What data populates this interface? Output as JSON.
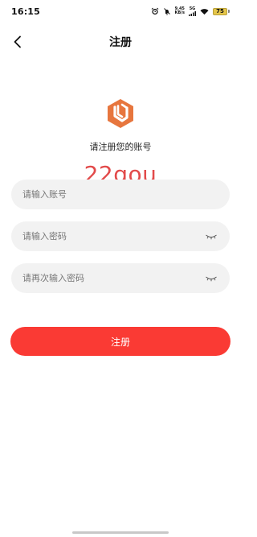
{
  "status_bar": {
    "time": "16:15",
    "net_speed_value": "9.45",
    "net_speed_unit": "KB/s",
    "network": "5G",
    "battery": "75",
    "icons": [
      "alarm-icon",
      "mute-icon",
      "wifi-icon",
      "battery-icon"
    ]
  },
  "nav": {
    "back_icon": "chevron-left-icon",
    "title": "注册"
  },
  "header": {
    "logo_icon": "app-logo-icon",
    "subtitle": "请注册您的账号",
    "watermark": "22gou"
  },
  "form": {
    "account_placeholder": "请输入账号",
    "account_value": "",
    "password_placeholder": "请输入密码",
    "password_value": "",
    "confirm_placeholder": "请再次输入密码",
    "confirm_value": "",
    "eye_icon": "eye-closed-icon"
  },
  "submit": {
    "label": "注册"
  },
  "colors": {
    "accent": "#fa3a34",
    "logo": "#e7763e",
    "watermark": "#e24a4a",
    "field_bg": "#f2f2f2"
  }
}
